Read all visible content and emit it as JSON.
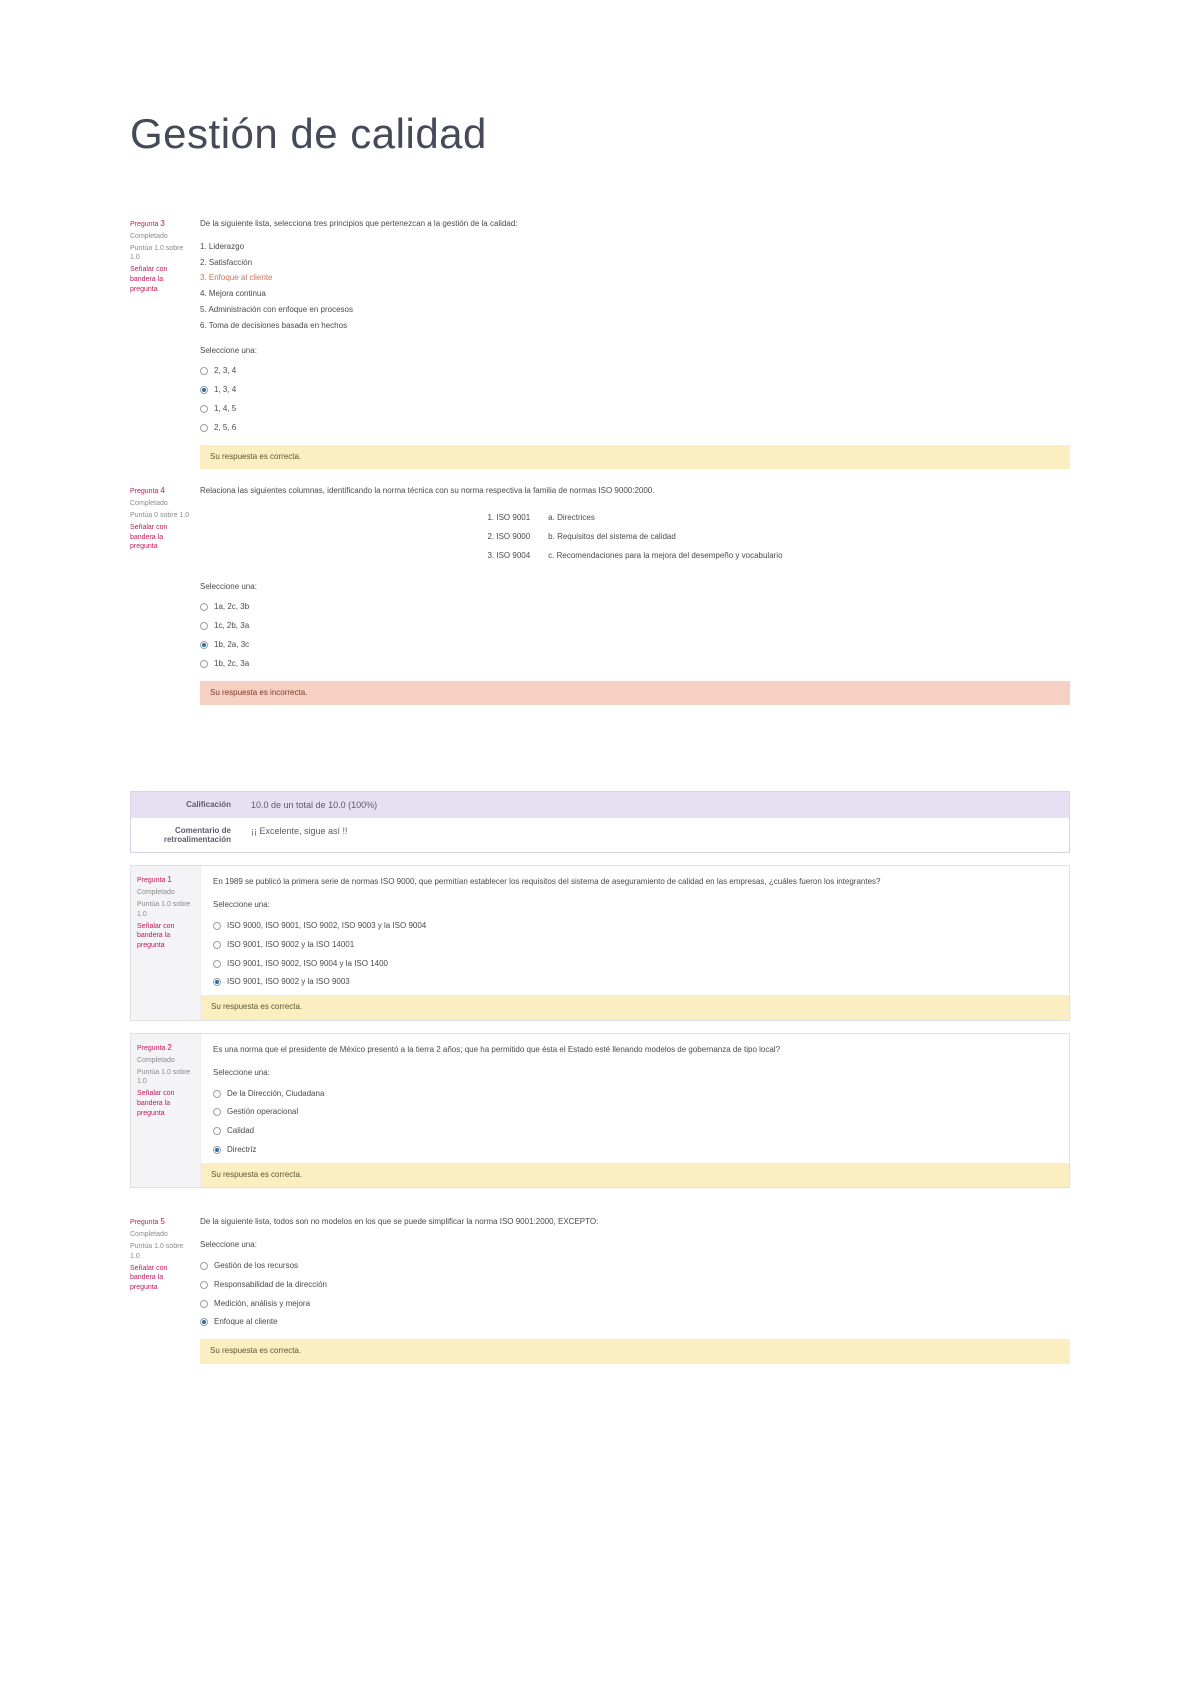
{
  "title": "Gestión de calidad",
  "q3": {
    "num_label": "Pregunta",
    "num": "3",
    "status": "Completado",
    "points": "Puntúa 1.0 sobre 1.0",
    "flag": "Señalar con bandera la pregunta",
    "stem": "De la siguiente lista, selecciona tres principios que pertenezcan a la gestión de la calidad:",
    "items": [
      "1. Liderazgo",
      "2. Satisfacción",
      "3. Enfoque al cliente",
      "4. Mejora continua",
      "5. Administración con enfoque en procesos",
      "6. Toma de decisiones basada en hechos"
    ],
    "prompt": "Seleccione una:",
    "options": [
      "2, 3, 4",
      "1, 3, 4",
      "1, 4, 5",
      "2, 5, 6"
    ],
    "selected_idx": 1,
    "feedback": "Su respuesta es correcta."
  },
  "q4": {
    "num_label": "Pregunta",
    "num": "4",
    "status": "Completado",
    "points": "Puntúa 0 sobre 1.0",
    "flag": "Señalar con bandera la pregunta",
    "stem": "Relaciona las siguientes columnas, identificando la norma técnica con su norma respectiva la familia de normas ISO 9000:2000.",
    "match": [
      [
        "1. ISO 9001",
        "a. Directrices"
      ],
      [
        "2. ISO 9000",
        "b. Requisitos del sistema de calidad"
      ],
      [
        "3. ISO 9004",
        "c. Recomendaciones para la mejora del desempeño y vocabulario"
      ]
    ],
    "prompt": "Seleccione una:",
    "options": [
      "1a, 2c, 3b",
      "1c, 2b, 3a",
      "1b, 2a, 3c",
      "1b, 2c, 3a"
    ],
    "selected_idx": 2,
    "feedback": "Su respuesta es incorrecta."
  },
  "grade": {
    "label": "Calificación",
    "value": "10.0 de un total de 10.0 (100%)",
    "comment_label": "Comentario de retroalimentación",
    "comment_value": "¡¡ Excelente, sigue así !!"
  },
  "q1": {
    "num_label": "Pregunta",
    "num": "1",
    "status": "Completado",
    "points": "Puntúa 1.0 sobre 1.0",
    "flag": "Señalar con bandera la pregunta",
    "stem": "En 1989 se publicó la primera serie de normas ISO 9000, que permitían establecer los requisitos del sistema de aseguramiento de calidad en las empresas, ¿cuáles fueron los integrantes?",
    "prompt": "Seleccione una:",
    "options": [
      "ISO 9000, ISO 9001, ISO 9002, ISO 9003 y la ISO 9004",
      "ISO 9001, ISO 9002 y la ISO 14001",
      "ISO 9001, ISO 9002, ISO 9004 y la ISO 1400",
      "ISO 9001, ISO 9002 y la ISO 9003"
    ],
    "selected_idx": 3,
    "feedback": "Su respuesta es correcta."
  },
  "q2": {
    "num_label": "Pregunta",
    "num": "2",
    "status": "Completado",
    "points": "Puntúa 1.0 sobre 1.0",
    "flag": "Señalar con bandera la pregunta",
    "stem": "Es una norma que el presidente de México presentó a la tierra 2 años; que ha permitido que ésta el Estado esté llenando modelos de gobernanza de tipo local?",
    "prompt": "Seleccione una:",
    "options": [
      "De la Dirección, Ciudadana",
      "Gestión operacional",
      "Calidad",
      "Directriz"
    ],
    "selected_idx": 3,
    "feedback": "Su respuesta es correcta."
  },
  "q5": {
    "num_label": "Pregunta",
    "num": "5",
    "status": "Completado",
    "points": "Puntúa 1.0 sobre 1.0",
    "flag": "Señalar con bandera la pregunta",
    "stem": "De la siguiente lista, todos son no modelos en los que se puede simplificar la norma ISO 9001:2000, EXCEPTO:",
    "prompt": "Seleccione una:",
    "options": [
      "Gestión de los recursos",
      "Responsabilidad de la dirección",
      "Medición, análisis y mejora",
      "Enfoque al cliente"
    ],
    "selected_idx": 3,
    "feedback": "Su respuesta es correcta."
  }
}
